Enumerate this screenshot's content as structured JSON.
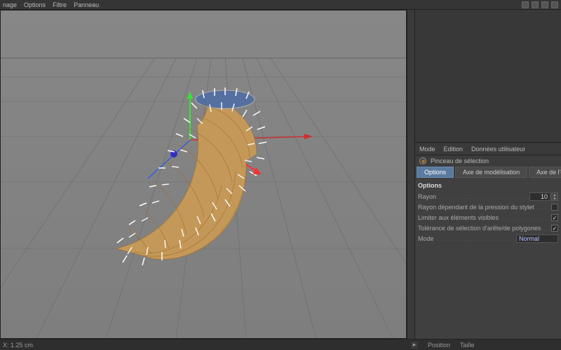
{
  "top_menu": {
    "image": "nage",
    "options": "Options",
    "filtre": "Filtre",
    "panneau": "Panneau"
  },
  "panel_menu": {
    "mode": "Mode",
    "edition": "Edition",
    "data": "Données utilisateur"
  },
  "tool": {
    "name": "Pinceau de sélection"
  },
  "tabs": {
    "options": "Options",
    "axe_model": "Axe de modélisation",
    "axe_obj": "Axe de l'obje"
  },
  "options": {
    "title": "Options",
    "rayon_label": "Rayon",
    "rayon_value": "10",
    "pression_label": "Rayon dépendant de la pression du stylet",
    "limiter_label": "Limiter aux éléments visibles",
    "tolerance_label": "Tolérance de sélection d'arête/de polygones",
    "mode_label": "Mode",
    "mode_value": "Normal"
  },
  "status": {
    "coords": "X: 1.25 cm",
    "position": "Position",
    "taille": "Taille"
  }
}
